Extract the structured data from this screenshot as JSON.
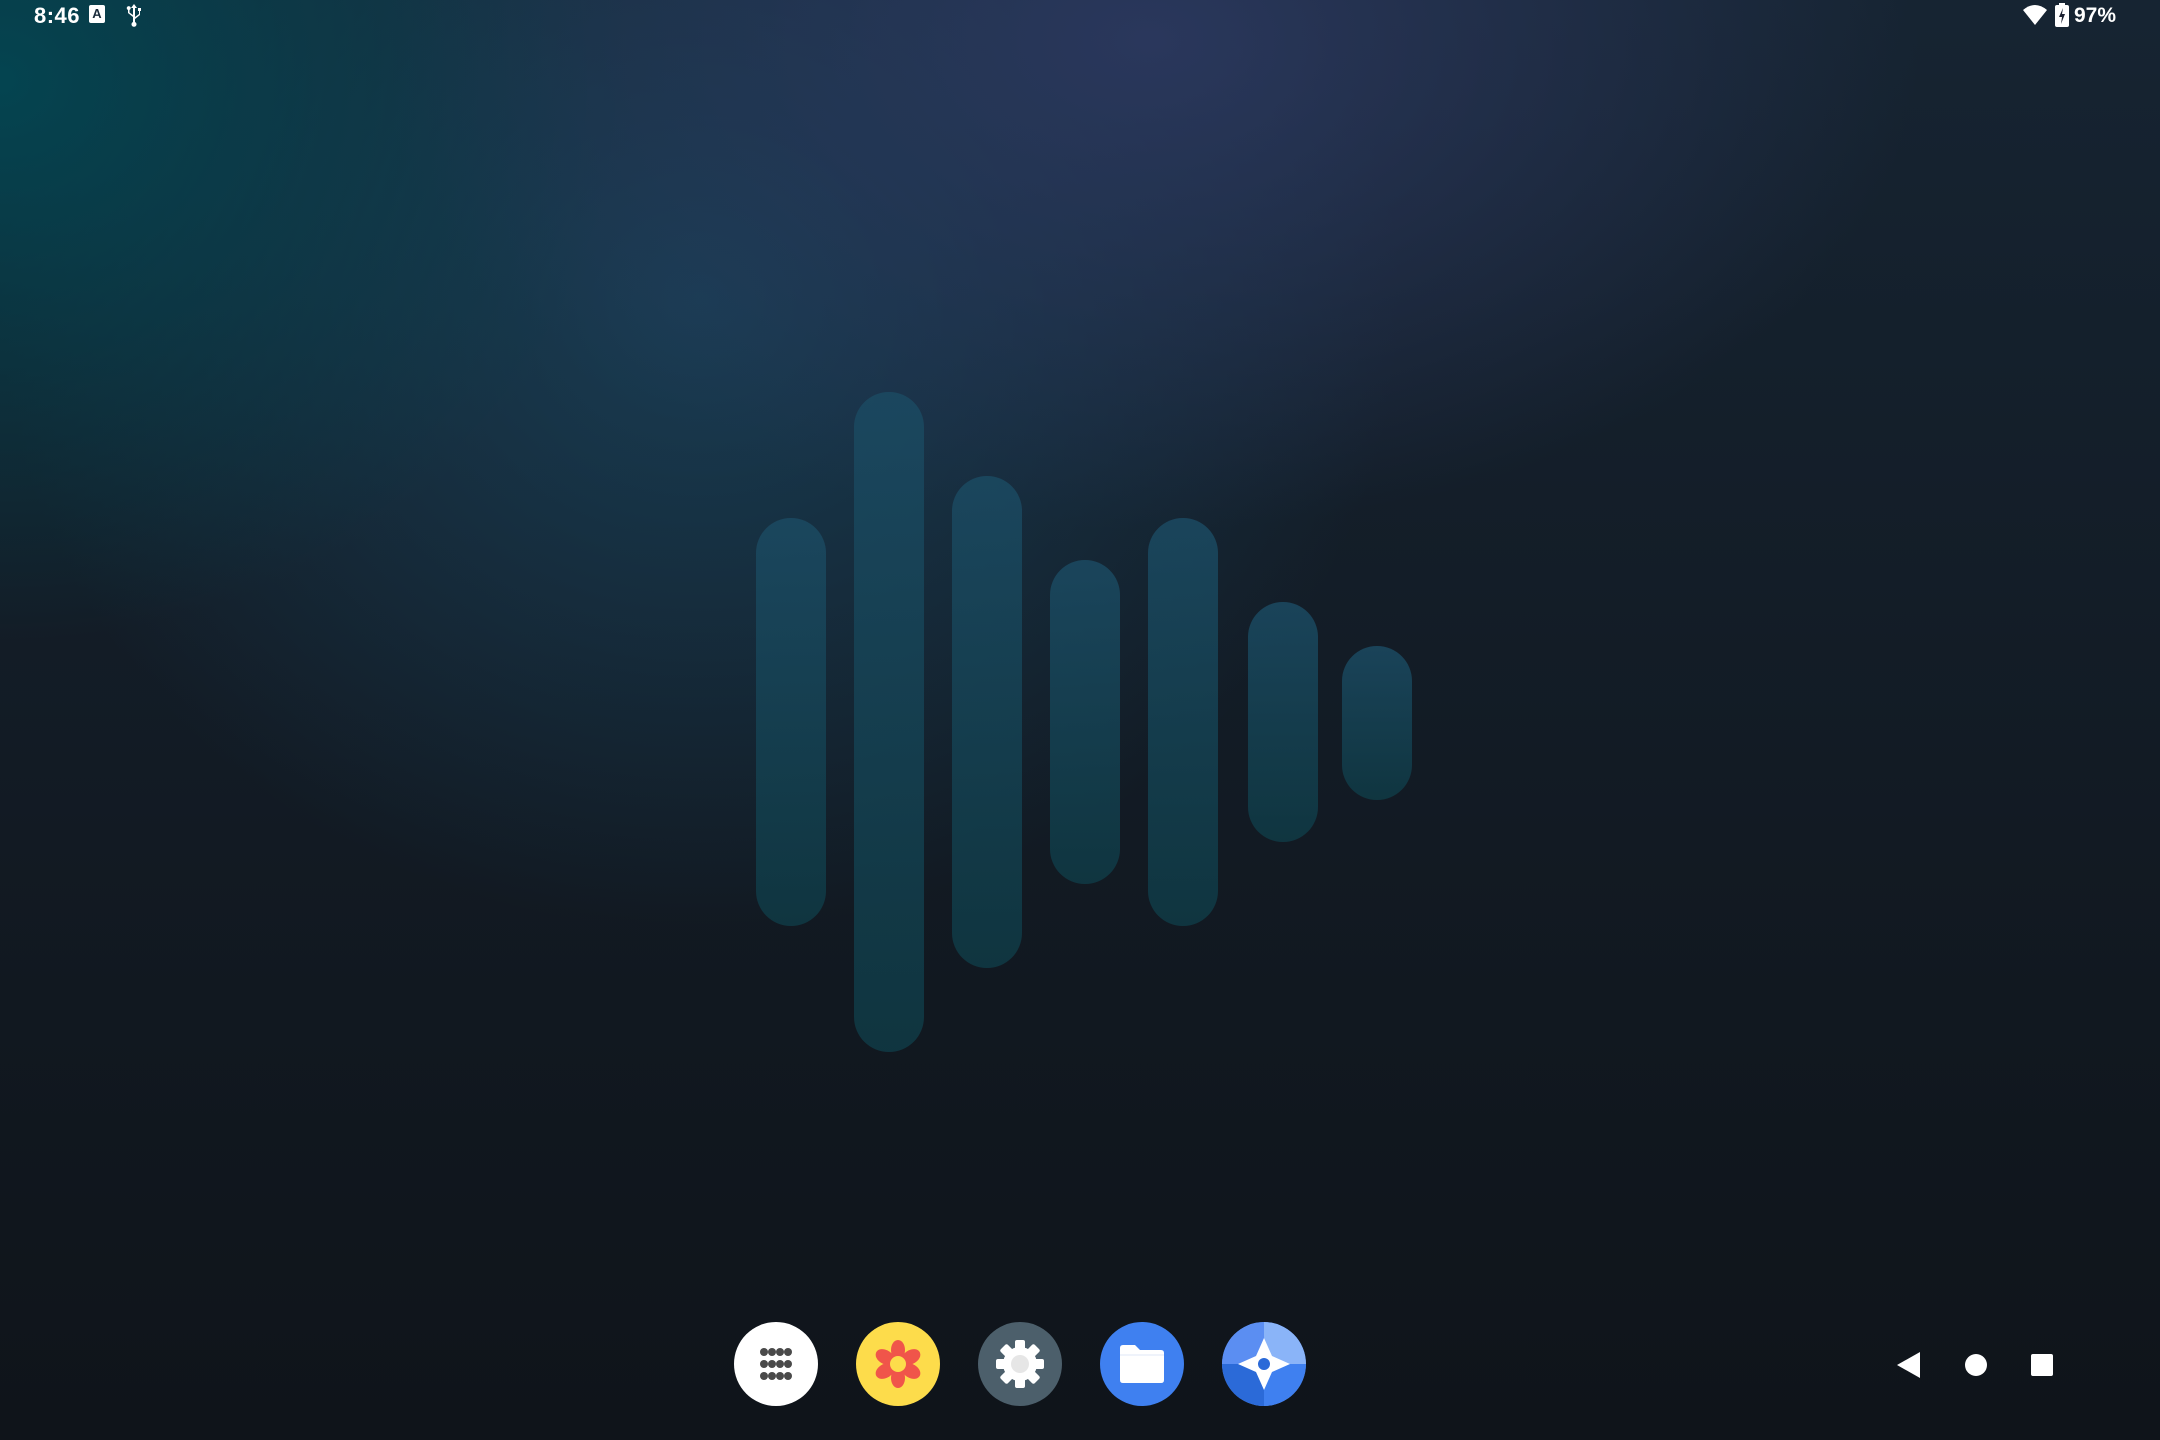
{
  "status_bar": {
    "time": "8:46",
    "keyboard_indicator": "A",
    "battery_percent": "97%",
    "icons": [
      "keyboard-a-icon",
      "usb-icon",
      "wifi-icon",
      "battery-charging-icon"
    ]
  },
  "wallpaper": {
    "logo": "sound-wave-logo",
    "colors": {
      "teal": "#034652",
      "indigo": "#2b385e",
      "base": "#121820",
      "bars": "#1a4a5a"
    }
  },
  "dock": {
    "items": [
      {
        "name": "app-drawer",
        "icon": "grid-dots-icon",
        "color": "#ffffff"
      },
      {
        "name": "gallery",
        "icon": "flower-icon",
        "color": "#fddc4b"
      },
      {
        "name": "settings",
        "icon": "gear-icon",
        "color": "#4c5f6b"
      },
      {
        "name": "files",
        "icon": "folder-icon",
        "color": "#3f80f0"
      },
      {
        "name": "maps",
        "icon": "compass-icon",
        "color": "#5b8ef2"
      }
    ]
  },
  "navigation_bar": {
    "buttons": [
      "back-triangle-icon",
      "home-circle-icon",
      "recents-square-icon"
    ]
  }
}
